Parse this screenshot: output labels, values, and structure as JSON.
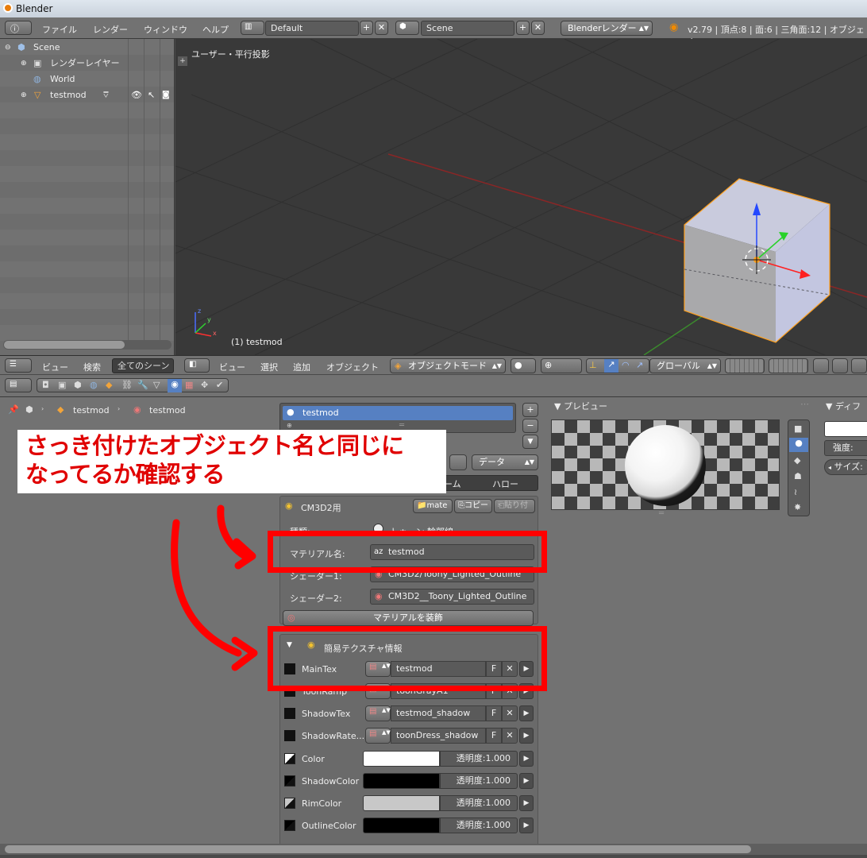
{
  "window": {
    "title": "Blender"
  },
  "top_menu": {
    "items": [
      "ファイル",
      "レンダー",
      "ウィンドウ",
      "ヘルプ"
    ],
    "layout": "Default",
    "scene": "Scene",
    "engine": "Blenderレンダー",
    "stats": "v2.79 | 頂点:8 | 面:6 | 三角面:12 | オブジェク"
  },
  "outliner": {
    "rows": [
      {
        "label": "Scene"
      },
      {
        "label": "レンダーレイヤー"
      },
      {
        "label": "World"
      },
      {
        "label": "testmod"
      }
    ]
  },
  "viewport": {
    "view_label": "ユーザー・平行投影",
    "object_label": "(1) testmod",
    "axes": {
      "x": "x",
      "y": "y",
      "z": "z"
    }
  },
  "viewport_header": {
    "outliner_menu": [
      "ビュー",
      "検索"
    ],
    "outliner_filter": "全てのシーン",
    "menu": [
      "ビュー",
      "選択",
      "追加",
      "オブジェクト"
    ],
    "mode": "オブジェクトモード",
    "orientation": "グローバル"
  },
  "properties": {
    "breadcrumb": [
      "testmod",
      "testmod"
    ],
    "material_slot": "testmod",
    "data_dropdown": "データ",
    "tabs_partial": [
      "ーム",
      "ハロー"
    ],
    "cm3d2": {
      "title": "CM3D2用",
      "buttons": [
        "mate",
        "コピー",
        "貼り付"
      ],
      "type_label": "種類:",
      "type_value": "トゥーン 輪郭線",
      "material_name_label": "マテリアル名:",
      "material_name": "testmod",
      "shader1_label": "シェーダー1:",
      "shader1": "CM3D2/Toony_Lighted_Outline",
      "shader2_label": "シェーダー2:",
      "shader2": "CM3D2__Toony_Lighted_Outline",
      "decorate_button": "マテリアルを装飾"
    },
    "texture_panel": {
      "title": "簡易テクスチャ情報",
      "textures": [
        {
          "name": "MainTex",
          "value": "testmod"
        },
        {
          "name": "ToonRamp",
          "value": "toonGrayA1"
        },
        {
          "name": "ShadowTex",
          "value": "testmod_shadow"
        },
        {
          "name": "ShadowRate...",
          "value": "toonDress_shadow"
        }
      ],
      "colors": [
        {
          "name": "Color",
          "alpha": "透明度:1.000",
          "color": "#ffffff"
        },
        {
          "name": "ShadowColor",
          "alpha": "透明度:1.000",
          "color": "#000000"
        },
        {
          "name": "RimColor",
          "alpha": "透明度:1.000",
          "color": "#c8c8c8"
        },
        {
          "name": "OutlineColor",
          "alpha": "透明度:1.000",
          "color": "#000000"
        }
      ],
      "f_label": "F"
    }
  },
  "preview": {
    "title": "▼ プレビュー",
    "diffuse_title": "▼ ディフ",
    "intensity": "強度:",
    "size": "サイズ:"
  },
  "annotation": {
    "text_line1": "さっき付けたオブジェクト名と同じに",
    "text_line2": "なってるか確認する",
    "color": "#ff0000"
  }
}
